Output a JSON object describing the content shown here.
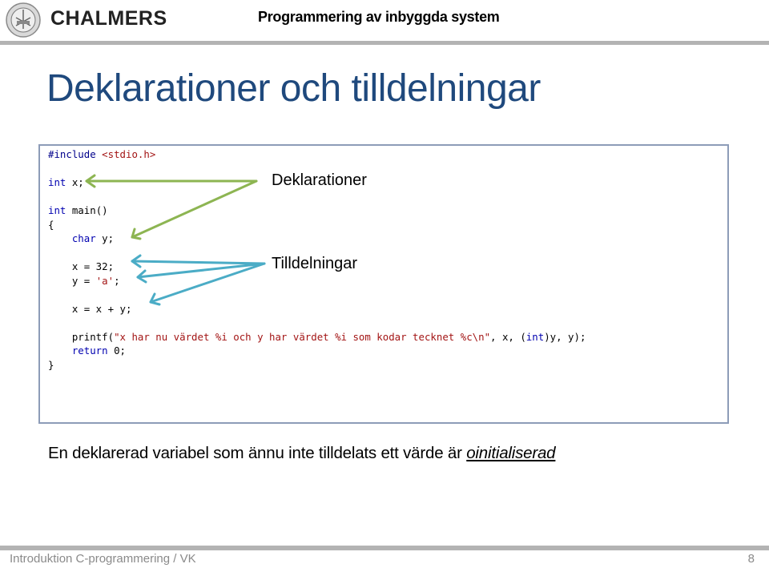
{
  "header": {
    "brand": "CHALMERS",
    "course_title": "Programmering av inbyggda system",
    "logo_icon": "chalmers-seal-icon"
  },
  "slide": {
    "title": "Deklarationer och tilldelningar",
    "code": {
      "include_directive": "#include",
      "include_file": "<stdio.h>",
      "lines": {
        "decl_x_kw": "int",
        "decl_x_rest": " x;",
        "main_kw": "int",
        "main_rest": " main()",
        "open_brace": "{",
        "decl_y_kw": "char",
        "decl_y_rest": " y;",
        "assign_x": "x = 32;",
        "assign_y_pre": "y = ",
        "assign_y_lit": "'a'",
        "assign_y_post": ";",
        "assign_sum": "x = x + y;",
        "printf_pre": "printf(",
        "printf_str": "\"x har nu värdet %i och y har värdet %i som kodar tecknet %c\\n\"",
        "printf_mid": ", x, (",
        "printf_cast_kw": "int",
        "printf_post": ")y, y);",
        "return_kw": "return",
        "return_rest": " 0;",
        "close_brace": "}"
      }
    },
    "annotations": {
      "declarations_label": "Deklarationer",
      "assignments_label": "Tilldelningar",
      "declarations_color": "#8db552",
      "assignments_color": "#4bacc6"
    },
    "note": {
      "text": "En deklarerad variabel som ännu inte tilldelats ett värde är ",
      "emphasis": "oinitialiserad"
    }
  },
  "footer": {
    "text": "Introduktion C-programmering / VK",
    "page_number": "8"
  }
}
